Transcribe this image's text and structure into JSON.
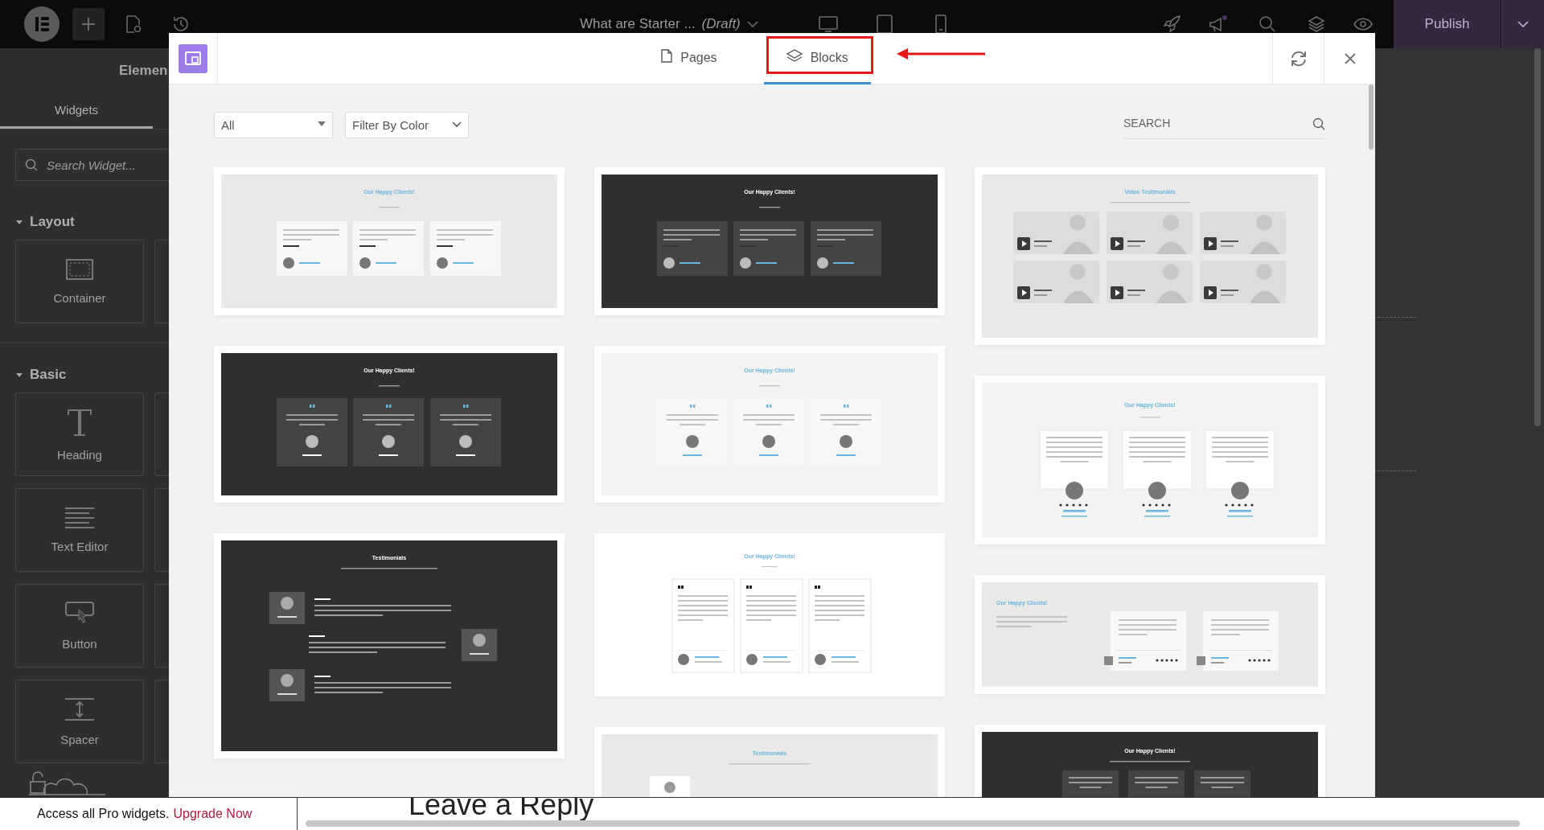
{
  "topbar": {
    "title": "What are Starter ...",
    "status": "(Draft)",
    "publish": "Publish"
  },
  "sidebar": {
    "title": "Elemen",
    "tab": "Widgets",
    "search_placeholder": "Search Widget...",
    "categories": [
      {
        "name": "Layout",
        "expanded": true,
        "widgets": [
          {
            "label": "Container",
            "kind": "container"
          }
        ]
      },
      {
        "name": "Basic",
        "expanded": true,
        "widgets": [
          {
            "label": "Heading",
            "kind": "heading"
          },
          {
            "label": "Text Editor",
            "kind": "text"
          },
          {
            "label": "Button",
            "kind": "button"
          },
          {
            "label": "Spacer",
            "kind": "spacer"
          }
        ]
      }
    ],
    "promo": {
      "text": "Access all Pro widgets.",
      "link": "Upgrade Now"
    }
  },
  "canvas": {
    "heading": "Leave a Reply"
  },
  "library": {
    "tabs": [
      {
        "label": "Pages",
        "kind": "pages",
        "selected": false
      },
      {
        "label": "Blocks",
        "kind": "blocks",
        "selected": true
      }
    ],
    "category_filter": "All",
    "color_filter": "Filter By Color",
    "search_placeholder": "SEARCH",
    "columns": [
      [
        {
          "kind": "cards3",
          "dark": false,
          "heading": "Our Happy Clients!"
        },
        {
          "kind": "quotes",
          "dark": true,
          "heading": "Our Happy Clients!"
        },
        {
          "kind": "zigzag",
          "dark": true,
          "heading": "Testimonials"
        }
      ],
      [
        {
          "kind": "cards3",
          "dark": true,
          "heading": "Our Happy Clients!"
        },
        {
          "kind": "quotes",
          "dark": false,
          "heading": "Our Happy Clients!"
        },
        {
          "kind": "quotecards",
          "dark": false,
          "heading": "Our Happy Clients!"
        },
        {
          "kind": "cut",
          "dark": false,
          "heading": "Testimonials"
        }
      ],
      [
        {
          "kind": "video",
          "dark": false,
          "heading": "Video Testimonials"
        },
        {
          "kind": "avatars",
          "dark": false,
          "heading": "Our Happy Clients!"
        },
        {
          "kind": "side",
          "dark": false,
          "heading": "Our Happy Clients!"
        },
        {
          "kind": "cut",
          "dark": true,
          "heading": "Our Happy Clients!"
        }
      ]
    ]
  }
}
